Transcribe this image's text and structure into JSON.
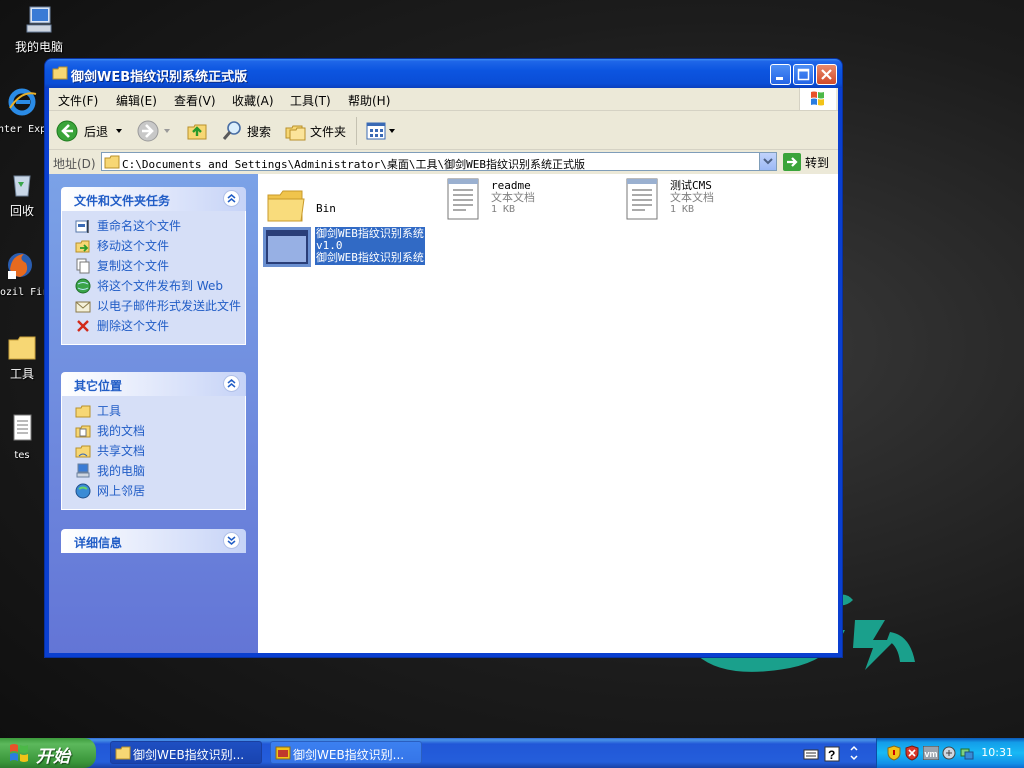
{
  "desktop": {
    "icons": [
      {
        "label": "我的电脑"
      },
      {
        "label": "Inter Explo"
      },
      {
        "label": "回收"
      },
      {
        "label": "Mozil Fire"
      },
      {
        "label": "工具"
      },
      {
        "label": "tes"
      }
    ]
  },
  "window": {
    "title": "御剑WEB指纹识别系统正式版",
    "menu": [
      "文件(F)",
      "编辑(E)",
      "查看(V)",
      "收藏(A)",
      "工具(T)",
      "帮助(H)"
    ],
    "toolbar": {
      "back": "后退",
      "search": "搜索",
      "folders": "文件夹"
    },
    "address": {
      "label": "地址(D)",
      "path": "C:\\Documents and Settings\\Administrator\\桌面\\工具\\御剑WEB指纹识别系统正式版",
      "go": "转到"
    },
    "panels": {
      "tasks": {
        "title": "文件和文件夹任务",
        "items": [
          "重命名这个文件",
          "移动这个文件",
          "复制这个文件",
          "将这个文件发布到 Web",
          "以电子邮件形式发送此文件",
          "删除这个文件"
        ]
      },
      "places": {
        "title": "其它位置",
        "items": [
          "工具",
          "我的文档",
          "共享文档",
          "我的电脑",
          "网上邻居"
        ]
      },
      "details": {
        "title": "详细信息"
      }
    },
    "files": [
      {
        "name": "Bin",
        "type": "folder"
      },
      {
        "name": "readme",
        "sub1": "文本文档",
        "sub2": "1 KB",
        "type": "text"
      },
      {
        "name": "测试CMS",
        "sub1": "文本文档",
        "sub2": "1 KB",
        "type": "text"
      },
      {
        "name": "御剑WEB指纹识别系统",
        "sub1": "v1.0",
        "sub2": "御剑WEB指纹识别系统",
        "type": "exe",
        "selected": true
      }
    ]
  },
  "taskbar": {
    "start": "开始",
    "buttons": [
      {
        "label": "御剑WEB指纹识别..."
      },
      {
        "label": "御剑WEB指纹识别..."
      }
    ],
    "clock": "10:31"
  },
  "colors": {
    "title_blue": "#0a4dd6",
    "link_blue": "#215dc6",
    "selection": "#316ac5",
    "taskbar_blue": "#245edb",
    "start_green": "#3a963a"
  }
}
